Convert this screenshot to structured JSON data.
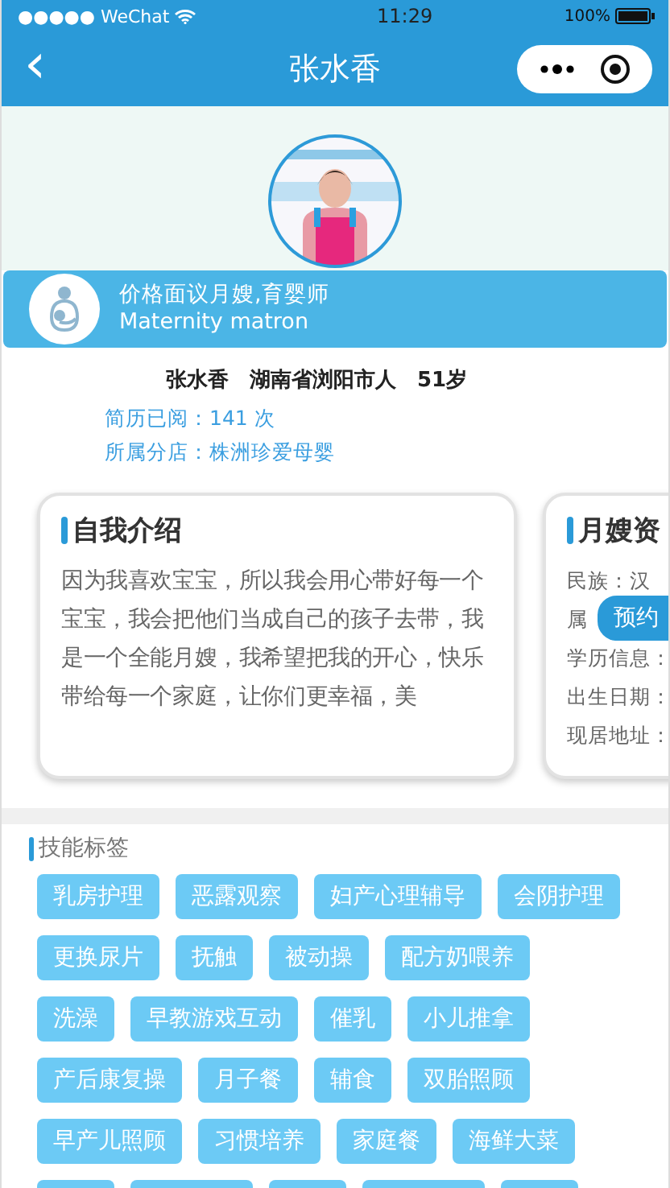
{
  "status_bar": {
    "carrier": "●●●●● WeChat",
    "time": "11:29",
    "battery": "100%"
  },
  "nav": {
    "back": "‹",
    "title": "张水香"
  },
  "profile": {
    "role": "价格面议月嫂,育婴师",
    "role_en": "Maternity matron"
  },
  "info": {
    "headline": "张水香　湖南省浏阳市人　51岁",
    "views": "简历已阅：141 次",
    "branch": "所属分店：株洲珍爱母婴"
  },
  "cards": [
    {
      "title": "自我介绍",
      "kind": "text",
      "body": "因为我喜欢宝宝，所以我会用心带好每一个宝宝，我会把他们当成自己的孩子去带，我是一个全能月嫂，我希望把我的开心，快乐带给每一个家庭，让你们更幸福，美"
    },
    {
      "title": "月嫂资",
      "kind": "list",
      "lines": [
        "民族：汉",
        "属",
        "学历信息：",
        "出生日期：",
        "现居地址："
      ]
    }
  ],
  "book_button": "预约",
  "skills": {
    "title": "技能标签",
    "tags": [
      "乳房护理",
      "恶露观察",
      "妇产心理辅导",
      "会阴护理",
      "更换尿片",
      "抚触",
      "被动操",
      "配方奶喂养",
      "洗澡",
      "早教游戏互动",
      "催乳",
      "小儿推拿",
      "产后康复操",
      "月子餐",
      "辅食",
      "双胎照顾",
      "早产儿照顾",
      "习惯培养",
      "家庭餐",
      "海鲜大菜"
    ]
  }
}
